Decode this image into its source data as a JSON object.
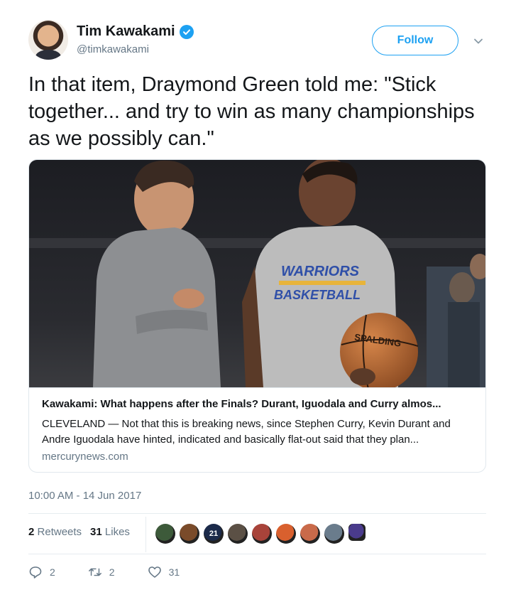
{
  "author": {
    "name": "Tim Kawakami",
    "handle": "@timkawakami",
    "verified": true
  },
  "follow_label": "Follow",
  "tweet": {
    "text": "In that item, Draymond Green told me: \"Stick together... and try to win as many championships as we possibly can.\""
  },
  "card": {
    "image_text": {
      "shirt_line1": "WARRIORS",
      "shirt_line2": "BASKETBALL",
      "ball_brand": "SPALDING"
    },
    "title": "Kawakami: What happens after the Finals? Durant, Iguodala and Curry almos...",
    "description": "CLEVELAND — Not that this is breaking news, since Stephen Curry, Kevin Durant and Andre Iguodala have hinted, indicated and basically flat-out said that they plan...",
    "domain": "mercurynews.com"
  },
  "timestamp": "10:00 AM - 14 Jun 2017",
  "stats": {
    "retweets_count": "2",
    "retweets_label": "Retweets",
    "likes_count": "31",
    "likes_label": "Likes"
  },
  "liker_colors": [
    "#3d5a3a",
    "#7a4b2a",
    "#1b2a4a",
    "#5b5045",
    "#a8433a",
    "#d9602e",
    "#c96a4a",
    "#6a7c8c",
    "#4a3b8c"
  ],
  "liker_badge_text": "21",
  "actions": {
    "reply_count": "2",
    "retweet_count": "2",
    "like_count": "31"
  },
  "colors": {
    "accent": "#1da1f2",
    "secondary_text": "#657786",
    "primary_text": "#14171a"
  }
}
